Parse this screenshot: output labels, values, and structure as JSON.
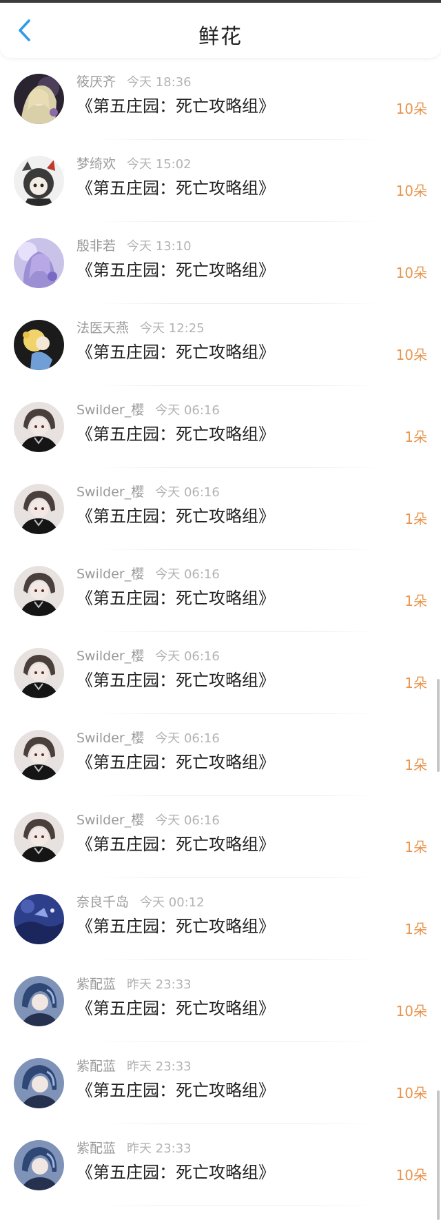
{
  "header": {
    "title": "鲜花"
  },
  "rows": [
    {
      "user": "筱厌齐",
      "time": "今天 18:36",
      "work": "《第五庄园：死亡攻略组》",
      "count": "10朵",
      "avatar": "a1"
    },
    {
      "user": "梦绮欢",
      "time": "今天 15:02",
      "work": "《第五庄园：死亡攻略组》",
      "count": "10朵",
      "avatar": "a2"
    },
    {
      "user": "殷非若",
      "time": "今天 13:10",
      "work": "《第五庄园：死亡攻略组》",
      "count": "10朵",
      "avatar": "a3"
    },
    {
      "user": "法医天燕",
      "time": "今天 12:25",
      "work": "《第五庄园：死亡攻略组》",
      "count": "10朵",
      "avatar": "a4"
    },
    {
      "user": "Swilder_樱",
      "time": "今天 06:16",
      "work": "《第五庄园：死亡攻略组》",
      "count": "1朵",
      "avatar": "a5"
    },
    {
      "user": "Swilder_樱",
      "time": "今天 06:16",
      "work": "《第五庄园：死亡攻略组》",
      "count": "1朵",
      "avatar": "a5"
    },
    {
      "user": "Swilder_樱",
      "time": "今天 06:16",
      "work": "《第五庄园：死亡攻略组》",
      "count": "1朵",
      "avatar": "a5"
    },
    {
      "user": "Swilder_樱",
      "time": "今天 06:16",
      "work": "《第五庄园：死亡攻略组》",
      "count": "1朵",
      "avatar": "a5"
    },
    {
      "user": "Swilder_樱",
      "time": "今天 06:16",
      "work": "《第五庄园：死亡攻略组》",
      "count": "1朵",
      "avatar": "a5"
    },
    {
      "user": "Swilder_樱",
      "time": "今天 06:16",
      "work": "《第五庄园：死亡攻略组》",
      "count": "1朵",
      "avatar": "a5"
    },
    {
      "user": "奈良千岛",
      "time": "今天 00:12",
      "work": "《第五庄园：死亡攻略组》",
      "count": "1朵",
      "avatar": "a6"
    },
    {
      "user": "紫配蓝",
      "time": "昨天 23:33",
      "work": "《第五庄园：死亡攻略组》",
      "count": "10朵",
      "avatar": "a7"
    },
    {
      "user": "紫配蓝",
      "time": "昨天 23:33",
      "work": "《第五庄园：死亡攻略组》",
      "count": "10朵",
      "avatar": "a7"
    },
    {
      "user": "紫配蓝",
      "time": "昨天 23:33",
      "work": "《第五庄园：死亡攻略组》",
      "count": "10朵",
      "avatar": "a7"
    }
  ],
  "colors": {
    "accent_blue": "#2f9be8",
    "count_orange": "#e8934a"
  },
  "icons": {
    "back": "chevron-left-icon"
  }
}
